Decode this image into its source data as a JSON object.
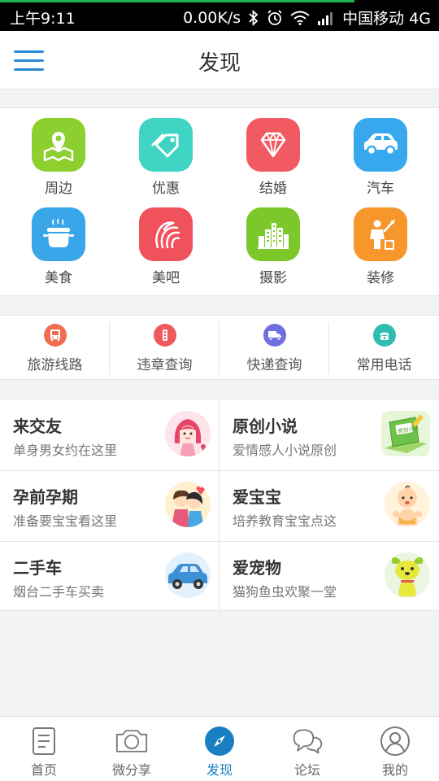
{
  "status_bar": {
    "time": "上午9:11",
    "network_speed": "0.00K/s",
    "carrier": "中国移动 4G",
    "icons": [
      "bluetooth-icon",
      "alarm-icon",
      "wifi-icon",
      "signal-icon"
    ]
  },
  "header": {
    "title": "发现",
    "menu_icon": "hamburger-menu-icon"
  },
  "categories": [
    {
      "label": "周边",
      "icon": "map-pin-icon",
      "color": "#8ccf2e"
    },
    {
      "label": "优惠",
      "icon": "tag-icon",
      "color": "#3fd4c3"
    },
    {
      "label": "结婚",
      "icon": "diamond-icon",
      "color": "#f25a62"
    },
    {
      "label": "汽车",
      "icon": "car-icon",
      "color": "#38a8ee"
    },
    {
      "label": "美食",
      "icon": "cooking-pot-icon",
      "color": "#3aa6ea"
    },
    {
      "label": "美吧",
      "icon": "beauty-hair-icon",
      "color": "#f0525c"
    },
    {
      "label": "摄影",
      "icon": "city-buildings-icon",
      "color": "#7cc72a"
    },
    {
      "label": "装修",
      "icon": "worker-icon",
      "color": "#f7962a"
    }
  ],
  "tools": [
    {
      "label": "旅游线路",
      "icon": "bus-icon",
      "color": "#f26d4f"
    },
    {
      "label": "违章查询",
      "icon": "traffic-light-icon",
      "color": "#ee5a5a"
    },
    {
      "label": "快递查询",
      "icon": "delivery-truck-icon",
      "color": "#6f6fe0"
    },
    {
      "label": "常用电话",
      "icon": "telephone-icon",
      "color": "#2fbdb0"
    }
  ],
  "features": [
    {
      "title": "来交友",
      "subtitle": "单身男女约在这里",
      "icon": "girl-avatar-icon"
    },
    {
      "title": "原创小说",
      "subtitle": "爱情感人小说原创",
      "icon": "book-icon",
      "badge": "原创小说"
    },
    {
      "title": "孕前孕期",
      "subtitle": "准备要宝宝看这里",
      "icon": "couple-icon"
    },
    {
      "title": "爱宝宝",
      "subtitle": "培养教育宝宝点这",
      "icon": "baby-icon"
    },
    {
      "title": "二手车",
      "subtitle": "烟台二手车买卖",
      "icon": "car-illustration-icon"
    },
    {
      "title": "爱宠物",
      "subtitle": "猫狗鱼虫欢聚一堂",
      "icon": "puppy-icon"
    }
  ],
  "bottom_nav": [
    {
      "label": "首页",
      "icon": "home-document-icon",
      "active": false
    },
    {
      "label": "微分享",
      "icon": "camera-icon",
      "active": false
    },
    {
      "label": "发现",
      "icon": "compass-icon",
      "active": true
    },
    {
      "label": "论坛",
      "icon": "chat-bubbles-icon",
      "active": false
    },
    {
      "label": "我的",
      "icon": "user-profile-icon",
      "active": false
    }
  ],
  "colors": {
    "accent": "#1a7fc0",
    "menu": "#2a8ad6",
    "background": "#f2f3f5"
  }
}
